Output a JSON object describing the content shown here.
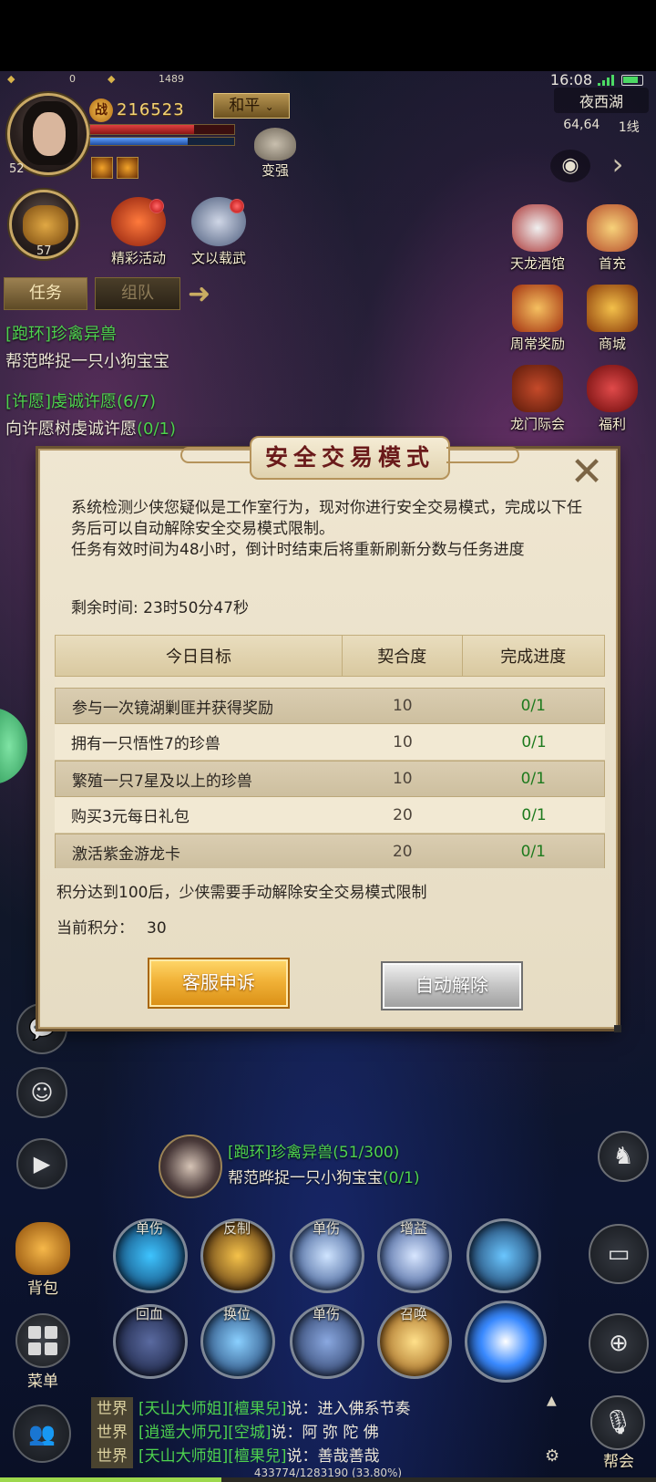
{
  "status": {
    "left_val_1": "0",
    "left_val_2": "1489",
    "time": "16:08"
  },
  "map": {
    "name": "夜西湖",
    "coord": "64,64",
    "line": "1线"
  },
  "player": {
    "level": "52",
    "power_icon": "战",
    "power": "216523",
    "pk_mode": "和平",
    "pk_mode_icon": "chevron-down-icon",
    "strengthen_label": "变强",
    "hp_fraction": 0.72,
    "mp_fraction": 0.68
  },
  "pet": {
    "level": "57"
  },
  "top_icons": {
    "events": "精彩活动",
    "wenyi": "文以载武",
    "tavern": "天龙酒馆",
    "recharge": "首充",
    "weekly": "周常奖励",
    "shop": "商城",
    "longmen": "龙门际会",
    "welfare": "福利"
  },
  "tabs": {
    "task": "任务",
    "team": "组队"
  },
  "quests": [
    {
      "title": "[跑环]珍禽异兽",
      "desc": "帮范晔捉一只小狗宝宝"
    },
    {
      "title": "[许愿]虔诚许愿(6/7)",
      "desc": "向许愿树虔诚许愿",
      "progress": "(0/1)"
    }
  ],
  "dialog": {
    "title": "安全交易模式",
    "text_1": "系统检测少侠您疑似是工作室行为，现对你进行安全交易模式，完成以下任务后可以自动解除安全交易模式限制。",
    "text_2": " 任务有效时间为48小时，倒计时结束后将重新刷新分数与任务进度",
    "remain_label": "剩余时间: ",
    "remain_value": "23时50分47秒",
    "table": {
      "headers": [
        "今日目标",
        "契合度",
        "完成进度"
      ],
      "rows": [
        {
          "goal": "参与一次镜湖剿匪并获得奖励",
          "score": "10",
          "progress": "0/1"
        },
        {
          "goal": "拥有一只悟性7的珍兽",
          "score": "10",
          "progress": "0/1"
        },
        {
          "goal": "繁殖一只7星及以上的珍兽",
          "score": "10",
          "progress": "0/1"
        },
        {
          "goal": "购买3元每日礼包",
          "score": "20",
          "progress": "0/1"
        },
        {
          "goal": "激活紫金游龙卡",
          "score": "20",
          "progress": "0/1"
        }
      ]
    },
    "note": "积分达到100后，少侠需要手动解除安全交易模式限制",
    "score_label": "当前积分：",
    "score_value": "30",
    "btn_appeal": "客服申诉",
    "btn_auto": "自动解除",
    "close_icon": "close-icon"
  },
  "npc_tracker": {
    "title": "[跑环]珍禽异兽(51/300)",
    "desc": "帮范晔捉一只小狗宝宝",
    "progress": "(0/1)"
  },
  "skills_row1": [
    "单伤",
    "反制",
    "单伤",
    "增益"
  ],
  "skills_row2": [
    "回血",
    "换位",
    "单伤",
    "召唤"
  ],
  "bag_label": "背包",
  "menu_label": "菜单",
  "guild_label": "帮会",
  "chat": [
    {
      "channel": "世界",
      "speaker": "[天山大师姐]",
      "name": "[檀果兒]",
      "said": "说：进入佛系节奏"
    },
    {
      "channel": "世界",
      "speaker": "[逍遥大师兄]",
      "name": "[空城]",
      "said": "说：阿 弥 陀 佛"
    },
    {
      "channel": "世界",
      "speaker": "[天山大师姐]",
      "name": "[檀果兒]",
      "said": "说：善哉善哉"
    }
  ],
  "exp": {
    "text": "433774/1283190 (33.80%)",
    "fraction": 0.338
  },
  "colors": {
    "quest_green": "#4ed24e",
    "dialog_bg": "#efe6d1",
    "title_red": "#6a1a1a",
    "progress_green": "#1d7a1d",
    "gold_button": "#f1b238"
  }
}
